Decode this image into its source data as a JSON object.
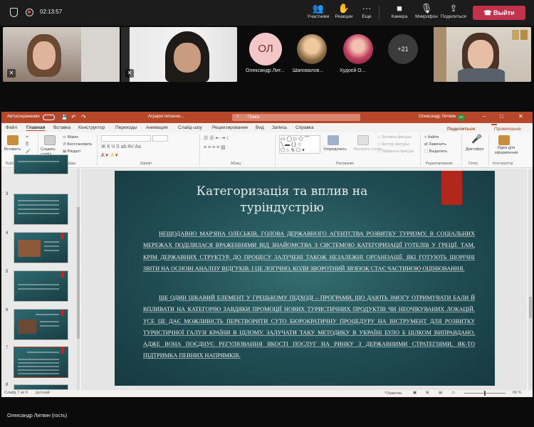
{
  "teams": {
    "time": "02:13:57",
    "toolbar": [
      {
        "icon": "people-icon",
        "label": "Участники"
      },
      {
        "icon": "reactions-icon",
        "label": "Реакции"
      },
      {
        "icon": "more-icon",
        "label": "Еще"
      },
      {
        "icon": "camera-icon",
        "label": "Камера"
      },
      {
        "icon": "mic-off-icon",
        "label": "Микрофон"
      },
      {
        "icon": "share-icon",
        "label": "Поделиться"
      }
    ],
    "leave_label": "Выйти",
    "participants": [
      {
        "initials": "ОЛ",
        "name": "Олександр Лит..."
      },
      {
        "name": "Шаповалов..."
      },
      {
        "name": "Худоєй О..."
      }
    ],
    "overflow_count": "+21",
    "presenter_caption": "Олександр Литвин (гость)"
  },
  "ppt": {
    "autosave": "Автосохранение",
    "filename": "Аграрні питання...",
    "search": "Поиск",
    "user": "Олександр Литвин",
    "user_initials": "АЛ",
    "menu": [
      "Файл",
      "Главная",
      "Вставка",
      "Конструктор",
      "Переходы",
      "Анимация",
      "Слайд-шоу",
      "Рецензирование",
      "Вид",
      "Запись",
      "Справка"
    ],
    "share": "Поделиться",
    "comments": "Примечания",
    "ribbon": {
      "paste": "Вставить",
      "create_slide": "Создать слайд",
      "layout": "Макет",
      "restore": "Восстановить",
      "section": "Раздел",
      "arrange": "Упорядочить",
      "quick_styles": "Экспресс-стили",
      "fill": "Заливка фигуры",
      "outline": "Контур фигуры",
      "effects": "Эффекты фигуры",
      "find": "Найти",
      "replace": "Заменить",
      "select": "Выделить",
      "dictation": "Диктофон",
      "ideas": "Идеи для оформления",
      "groups": [
        "Буфер обмена",
        "Слайды",
        "Шрифт",
        "Абзац",
        "Рисование",
        "Редактирование",
        "Голос",
        "Конструктор"
      ]
    },
    "thumb_numbers": [
      "3",
      "4",
      "5",
      "6",
      "7",
      "8"
    ],
    "slide": {
      "title_line1": "Категоризація та вплив на",
      "title_line2": "туріндустрію",
      "para1": "НЕЩОДАВНО МАР'ЯНА ОЛЕСЬКІВ, ГОЛОВА ДЕРЖАВНОГО АГЕНТСТВА РОЗВИТКУ ТУРИЗМУ, В СОЦІАЛЬНИХ МЕРЕЖАХ ПОДІЛИЛАСЯ ВРАЖЕННЯМИ ВІД ЗНАЙОМСТВА З СИСТЕМОЮ КАТЕГОРИЗАЦІЇ ГОТЕЛІВ У ГРЕЦІЇ. ТАМ, КРІМ ДЕРЖАВНИХ СТРУКТУР, ДО ПРОЦЕСУ ЗАЛУЧЕНІ ТАКОЖ НЕЗАЛЕЖНІ ОРГАНІЗАЦІЇ, ЯКІ ГОТУЮТЬ ЩОРІЧНІ ЗВІТИ НА ОСНОВІ АНАЛІЗУ ВІДГУКІВ. І ЦЕ ЛОГІЧНО, КОЛИ ЗВОРОТНИЙ ЗВ'ЯЗОК СТАЄ ЧАСТИНОЮ ОЦІНЮВАННЯ.",
      "para2": "ЩЕ ОДИН ЦІКАВИЙ ЕЛЕМЕНТ У ГРЕЦЬКОМУ ПІДХОДІ – ПРОГРАМИ, ЩО ДАЮТЬ ЗМОГУ ОТРИМУВАТИ БАЛИ Й ВПЛИВАТИ НА КАТЕГОРІЮ ЗАВДЯКИ ПРОМОЦІЇ НОВИХ ТУРИСТИЧНИХ ПРОДУКТІВ ЧИ НЕОЧІКУВАНИХ ЛОКАЦІЙ. УСЕ ЦЕ ДАЄ МОЖЛИВІСТЬ ПЕРЕТВОРИТИ СУТО БЮРОКРАТИЧНУ ПРОЦЕДУРУ НА ІНСТРУМЕНТ ДЛЯ РОЗВИТКУ ТУРИСТИЧНОЇ ГАЛУЗІ КРАЇНИ В ЦІЛОМУ. ЗАЛУЧАТИ ТАКУ МЕТОДИКУ В УКРАЇНІ БУЛО Б ЦІЛКОМ ВИПРАВДАНО, АДЖЕ ВОНА ПОЄДНУЄ РЕГУЛЮВАННЯ ЯКОСТІ ПОСЛУГ НА РИНКУ З ДЕРЖАВНИМИ СТРАТЕГІЯМИ, ЯК-ТО ПІДТРИМКА ПЕВНИХ НАПРЯМКІВ."
    },
    "status": {
      "slide_counter": "Слайд 7 из 9",
      "language": "русский",
      "notes": "Заметки",
      "zoom": "69 %"
    }
  }
}
